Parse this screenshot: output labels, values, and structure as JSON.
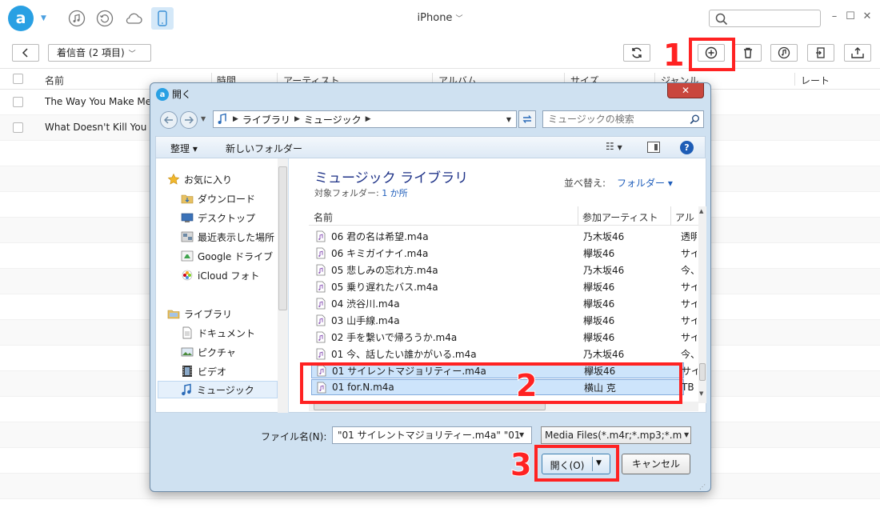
{
  "app": {
    "device_name": "iPhone",
    "search_placeholder": "",
    "logo_letter": "a"
  },
  "toolbar": {
    "category_label": "着信音 (2 項目)"
  },
  "list": {
    "columns": [
      "名前",
      "時間",
      "アーティスト",
      "アルバム",
      "サイズ",
      "ジャンル",
      "レート"
    ],
    "rows": [
      {
        "name": "The Way You Make Me Feel"
      },
      {
        "name": "What Doesn't Kill You (Stronger)"
      }
    ]
  },
  "dialog": {
    "title": "開く",
    "close_label": "✕",
    "breadcrumbs": [
      "ライブラリ",
      "ミュージック"
    ],
    "search_placeholder": "ミュージックの検索",
    "organize_label": "整理 ▾",
    "new_folder_label": "新しいフォルダー",
    "help_label": "?",
    "nav": {
      "favorites": "お気に入り",
      "downloads": "ダウンロード",
      "desktop": "デスクトップ",
      "recent": "最近表示した場所",
      "google_drive": "Google ドライブ",
      "icloud_photos": "iCloud フォト",
      "libraries": "ライブラリ",
      "documents": "ドキュメント",
      "pictures": "ピクチャ",
      "videos": "ビデオ",
      "music": "ミュージック"
    },
    "library_title": "ミュージック ライブラリ",
    "library_subtitle_prefix": "対象フォルダー: ",
    "library_subtitle_link": "1 か所",
    "sort_label": "並べ替え:",
    "sort_value": "フォルダー ▾",
    "file_columns": {
      "name": "名前",
      "artist": "参加アーティスト",
      "album": "アル"
    },
    "files": [
      {
        "name": "06 君の名は希望.m4a",
        "artist": "乃木坂46",
        "album": "透明"
      },
      {
        "name": "06 キミガイナイ.m4a",
        "artist": "欅坂46",
        "album": "サイ"
      },
      {
        "name": "05 悲しみの忘れ方.m4a",
        "artist": "乃木坂46",
        "album": "今、"
      },
      {
        "name": "05 乗り遅れたバス.m4a",
        "artist": "欅坂46",
        "album": "サイ"
      },
      {
        "name": "04 渋谷川.m4a",
        "artist": "欅坂46",
        "album": "サイ"
      },
      {
        "name": "03 山手線.m4a",
        "artist": "欅坂46",
        "album": "サイ"
      },
      {
        "name": "02 手を繋いで帰ろうか.m4a",
        "artist": "欅坂46",
        "album": "サイ"
      },
      {
        "name": "01 今、話したい誰かがいる.m4a",
        "artist": "乃木坂46",
        "album": "今、"
      },
      {
        "name": "01 サイレントマジョリティー.m4a",
        "artist": "欅坂46",
        "album": "サイ"
      },
      {
        "name": "01 for.N.m4a",
        "artist": "横山 克",
        "album": "TB"
      }
    ],
    "filename_label": "ファイル名(N):",
    "filename_value": "\"01 サイレントマジョリティー.m4a\" \"01",
    "filter_value": "Media Files(*.m4r;*.mp3;*.m",
    "open_label": "開く(O)",
    "cancel_label": "キャンセル"
  },
  "callouts": [
    "1",
    "2",
    "3"
  ],
  "colors": {
    "accent": "#29a0e3",
    "callout": "#ff2222",
    "selection": "#cde4fb",
    "dialog_frame": "#cfe1f1"
  }
}
